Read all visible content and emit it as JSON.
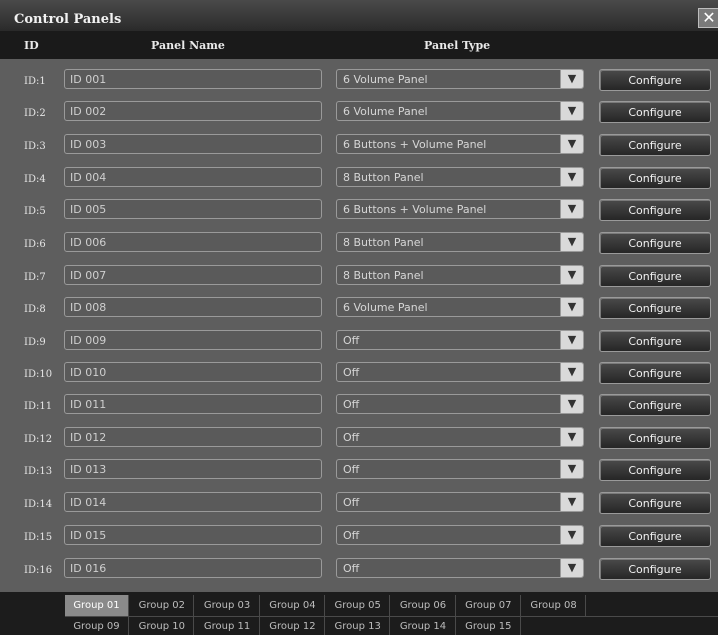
{
  "window": {
    "title": "Control Panels",
    "close_symbol": "✕"
  },
  "header": {
    "id": "ID",
    "name": "Panel Name",
    "type": "Panel Type"
  },
  "configure_label": "Configure",
  "dropdown_arrow": "▼",
  "rows": [
    {
      "id": "ID:1",
      "name": "ID 001",
      "type": "6 Volume Panel"
    },
    {
      "id": "ID:2",
      "name": "ID 002",
      "type": "6 Volume Panel"
    },
    {
      "id": "ID:3",
      "name": "ID 003",
      "type": "6 Buttons + Volume Panel"
    },
    {
      "id": "ID:4",
      "name": "ID 004",
      "type": "8 Button Panel"
    },
    {
      "id": "ID:5",
      "name": "ID 005",
      "type": "6 Buttons + Volume Panel"
    },
    {
      "id": "ID:6",
      "name": "ID 006",
      "type": "8 Button Panel"
    },
    {
      "id": "ID:7",
      "name": "ID 007",
      "type": "8 Button Panel"
    },
    {
      "id": "ID:8",
      "name": "ID 008",
      "type": "6 Volume Panel"
    },
    {
      "id": "ID:9",
      "name": "ID 009",
      "type": "Off"
    },
    {
      "id": "ID:10",
      "name": "ID 010",
      "type": "Off"
    },
    {
      "id": "ID:11",
      "name": "ID 011",
      "type": "Off"
    },
    {
      "id": "ID:12",
      "name": "ID 012",
      "type": "Off"
    },
    {
      "id": "ID:13",
      "name": "ID 013",
      "type": "Off"
    },
    {
      "id": "ID:14",
      "name": "ID 014",
      "type": "Off"
    },
    {
      "id": "ID:15",
      "name": "ID 015",
      "type": "Off"
    },
    {
      "id": "ID:16",
      "name": "ID 016",
      "type": "Off"
    }
  ],
  "groups_row1": [
    "Group 01",
    "Group 02",
    "Group 03",
    "Group 04",
    "Group 05",
    "Group 06",
    "Group 07",
    "Group 08"
  ],
  "groups_row2": [
    "Group 09",
    "Group 10",
    "Group 11",
    "Group 12",
    "Group 13",
    "Group 14",
    "Group 15"
  ],
  "active_group": "Group 01",
  "colors": {
    "background": "#5e5e5e",
    "header": "#1a1a1a",
    "active_tab": "#8a8a8a"
  }
}
